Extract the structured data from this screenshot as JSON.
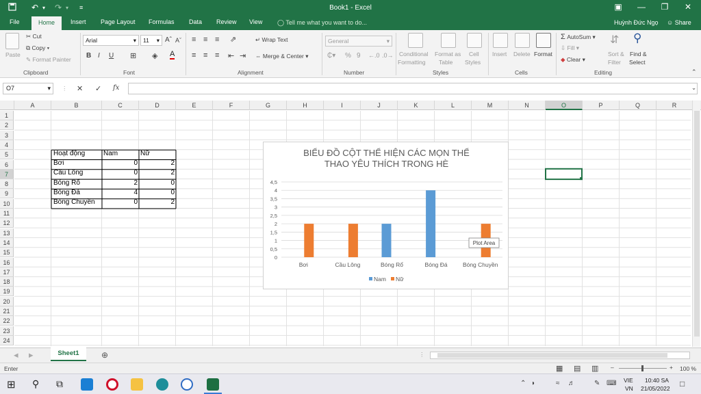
{
  "titlebar": {
    "document_title": "Book1 - Excel",
    "user": "Huỳnh Đức Ngọ",
    "share": "Share"
  },
  "tabs": [
    "File",
    "Home",
    "Insert",
    "Page Layout",
    "Formulas",
    "Data",
    "Review",
    "View"
  ],
  "tell_me": "Tell me what you want to do...",
  "ribbon": {
    "clipboard": {
      "label": "Clipboard",
      "paste": "Paste",
      "cut": "Cut",
      "copy": "Copy",
      "format_painter": "Format Painter"
    },
    "font": {
      "label": "Font",
      "font_name": "Arial",
      "font_size": "11",
      "bold": "B",
      "italic": "I",
      "underline": "U"
    },
    "alignment": {
      "label": "Alignment",
      "wrap_text": "Wrap Text",
      "merge_center": "Merge & Center"
    },
    "number": {
      "label": "Number",
      "format": "General",
      "percent": "%",
      "comma": "9"
    },
    "styles": {
      "label": "Styles",
      "conditional": "Conditional",
      "formatting": "Formatting",
      "format_as": "Format as",
      "table": "Table",
      "cell": "Cell",
      "styles": "Styles"
    },
    "cells": {
      "label": "Cells",
      "insert": "Insert",
      "delete": "Delete",
      "format": "Format"
    },
    "editing": {
      "label": "Editing",
      "autosum": "AutoSum",
      "fill": "Fill",
      "clear": "Clear",
      "sort_filter": "Sort &",
      "filter": "Filter",
      "find_select": "Find &",
      "select": "Select"
    }
  },
  "formula_bar": {
    "name_box": "O7",
    "fx": "fx",
    "value": ""
  },
  "columns": [
    "A",
    "B",
    "C",
    "D",
    "E",
    "F",
    "G",
    "H",
    "I",
    "J",
    "K",
    "L",
    "M",
    "N",
    "O",
    "P",
    "Q",
    "R"
  ],
  "rows": [
    "1",
    "2",
    "3",
    "4",
    "5",
    "6",
    "7",
    "8",
    "9",
    "10",
    "11",
    "12",
    "13",
    "14",
    "15",
    "16",
    "17",
    "18",
    "19",
    "20",
    "21",
    "22",
    "23",
    "24"
  ],
  "table": {
    "headers": [
      "Hoạt động",
      "Nam",
      "Nữ"
    ],
    "rows": [
      [
        "Bơi",
        "0",
        "2"
      ],
      [
        "Cầu Lông",
        "0",
        "2"
      ],
      [
        "Bóng Rổ",
        "2",
        "0"
      ],
      [
        "Bóng Đá",
        "4",
        "0"
      ],
      [
        "Bóng Chuyền",
        "0",
        "2"
      ]
    ]
  },
  "chart_data": {
    "type": "bar",
    "title": "BIỂU ĐỒ CỘT THỂ HIỆN CÁC MỌN THỂ THAO YÊU THÍCH TRONG HÈ",
    "title_line1": "BIỂU ĐỒ CỘT THỂ HIỆN CÁC MỌN THỂ",
    "title_line2": "THAO YÊU THÍCH TRONG HÈ",
    "categories": [
      "Bơi",
      "Cầu Lông",
      "Bóng Rổ",
      "Bóng Đá",
      "Bóng Chuyền"
    ],
    "series": [
      {
        "name": "Nam",
        "values": [
          0,
          0,
          2,
          4,
          0
        ],
        "color": "#5b9bd5"
      },
      {
        "name": "Nữ",
        "values": [
          2,
          2,
          0,
          0,
          2
        ],
        "color": "#ed7d31"
      }
    ],
    "y_ticks": [
      "0",
      "0,5",
      "1",
      "1,5",
      "2",
      "2,5",
      "3",
      "3,5",
      "4",
      "4,5"
    ],
    "ylim": [
      0,
      4.5
    ],
    "grid": true,
    "legend": "bottom",
    "tooltip": "Plot Area"
  },
  "sheets": [
    "Sheet1"
  ],
  "status": {
    "mode": "Enter",
    "zoom": "100 %"
  },
  "taskbar": {
    "lang1": "VIE",
    "lang2": "VN",
    "time": "10:40 SA",
    "date": "21/05/2022"
  },
  "colors": {
    "excel_green": "#217346",
    "nam": "#5b9bd5",
    "nu": "#ed7d31"
  }
}
